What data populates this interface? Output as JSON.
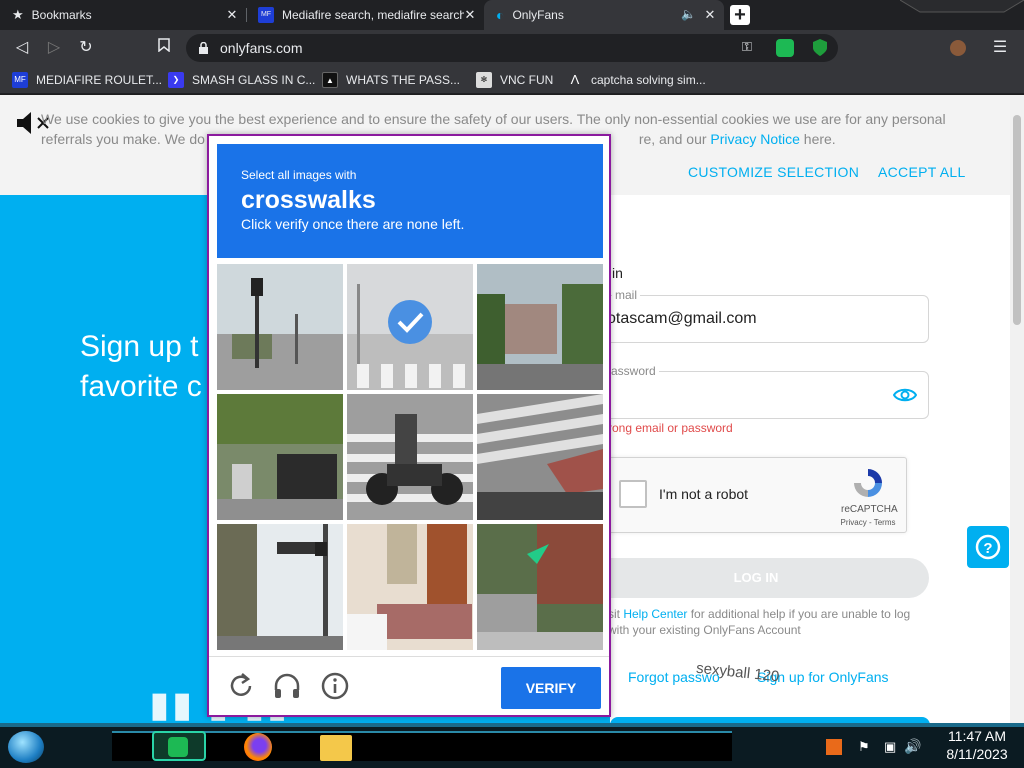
{
  "tabs": [
    {
      "title": "Bookmarks",
      "icon": "star-icon"
    },
    {
      "title": "Mediafire search, mediafire search",
      "icon": "mediafire-icon"
    },
    {
      "title": "OnlyFans",
      "icon": "onlyfans-icon"
    }
  ],
  "url": "onlyfans.com",
  "bookmarks": [
    {
      "label": "MEDIAFIRE ROULET...",
      "color": "#1e3ed6"
    },
    {
      "label": "SMASH GLASS IN C...",
      "color": "#3a3af0"
    },
    {
      "label": "WHATS THE PASS...",
      "color": "#111111"
    },
    {
      "label": "VNC FUN",
      "color": "#dddddd"
    },
    {
      "label": "captcha solving sim...",
      "color": "#35363a"
    }
  ],
  "cookie": {
    "text_a": "We use cookies to give you the best experience and to ensure the safety of our users. The only non-essential cookies we use are for any personal referrals you make. We do",
    "text_b": "re, and our",
    "privacy": "Privacy Notice",
    "text_c": "here.",
    "customize": "CUSTOMIZE SELECTION",
    "accept": "ACCEPT ALL"
  },
  "hero": {
    "line1": "Sign up t",
    "line2": "favorite c"
  },
  "login": {
    "heading": "in",
    "email_label": "mail",
    "email_value": "otascam@gmail.com",
    "password_label": "assword",
    "error": "rong email or password",
    "robot": "I'm not a robot",
    "recaptcha": "reCAPTCHA",
    "terms": "Privacy - Terms",
    "button": "LOG IN",
    "help_a": "sit",
    "help_link": "Help Center",
    "help_b": "for additional help if you are unable to log",
    "help_c": "with your existing OnlyFans Account",
    "forgot": "Forgot passwo",
    "signup": "Sign up for OnlyFans",
    "overlay_text": "sexyball 120"
  },
  "captcha": {
    "line1": "Select all images with",
    "line2": "crosswalks",
    "line3": "Click verify once there are none left.",
    "verify": "VERIFY",
    "selected_tile": 2
  },
  "taskbar": {
    "time": "11:47 AM",
    "date": "8/11/2023"
  },
  "colors": {
    "accent": "#00aff0",
    "captcha_blue": "#1a73e8",
    "captcha_border": "#8b1a9e"
  }
}
